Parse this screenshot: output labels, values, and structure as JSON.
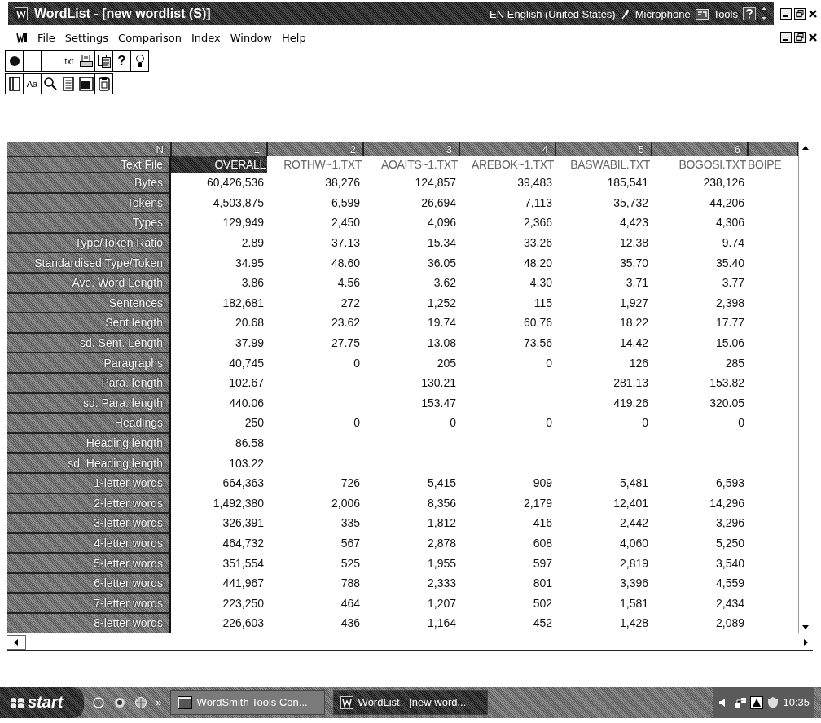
{
  "window": {
    "title": "WordList - [new wordlist (S)]"
  },
  "language_bar": {
    "language": "EN English (United States)",
    "microphone": "Microphone",
    "tools": "Tools"
  },
  "menu": [
    "File",
    "Settings",
    "Comparison",
    "Index",
    "Window",
    "Help"
  ],
  "toolbars": [
    [
      {
        "kind": "icon"
      },
      {
        "kind": "icon"
      },
      {
        "kind": "icon"
      },
      {
        "kind": "text",
        "label": ".txt"
      },
      {
        "kind": "icon"
      },
      {
        "kind": "icon"
      },
      {
        "kind": "text",
        "label": "?"
      },
      {
        "kind": "icon"
      }
    ],
    [
      {
        "kind": "icon"
      },
      {
        "kind": "text",
        "label": "Aa"
      },
      {
        "kind": "icon"
      },
      {
        "kind": "icon"
      },
      {
        "kind": "icon"
      },
      {
        "kind": "icon"
      }
    ]
  ],
  "grid": {
    "corner": "N",
    "file_row_label": "Text File",
    "columns": [
      {
        "number": "1",
        "file": "OVERALL",
        "selected": true
      },
      {
        "number": "2",
        "file": "ROTHW~1.TXT",
        "selected": false
      },
      {
        "number": "3",
        "file": "AOAITS~1.TXT",
        "selected": false
      },
      {
        "number": "4",
        "file": "AREBOK~1.TXT",
        "selected": false
      },
      {
        "number": "5",
        "file": "BASWABIL.TXT",
        "selected": false
      },
      {
        "number": "6",
        "file": "BOGOSI.TXT",
        "selected": false
      },
      {
        "file": "BOIPE",
        "selected": false
      }
    ],
    "rows": [
      {
        "label": "Bytes",
        "values": {
          "column_1": "60,426,536",
          "column_2": "38,276",
          "column_3": "124,857",
          "column_4": "39,483",
          "column_5": "185,541",
          "column_6": "238,126"
        }
      },
      {
        "label": "Tokens",
        "values": {
          "column_1": "4,503,875",
          "column_2": "6,599",
          "column_3": "26,694",
          "column_4": "7,113",
          "column_5": "35,732",
          "column_6": "44,206"
        }
      },
      {
        "label": "Types",
        "values": {
          "column_1": "129,949",
          "column_2": "2,450",
          "column_3": "4,096",
          "column_4": "2,366",
          "column_5": "4,423",
          "column_6": "4,306"
        }
      },
      {
        "label": "Type/Token Ratio",
        "values": {
          "column_1": "2.89",
          "column_2": "37.13",
          "column_3": "15.34",
          "column_4": "33.26",
          "column_5": "12.38",
          "column_6": "9.74"
        }
      },
      {
        "label": "Standardised Type/Token",
        "values": {
          "column_1": "34.95",
          "column_2": "48.60",
          "column_3": "36.05",
          "column_4": "48.20",
          "column_5": "35.70",
          "column_6": "35.40"
        }
      },
      {
        "label": "Ave. Word Length",
        "values": {
          "column_1": "3.86",
          "column_2": "4.56",
          "column_3": "3.62",
          "column_4": "4.30",
          "column_5": "3.71",
          "column_6": "3.77"
        }
      },
      {
        "label": "Sentences",
        "values": {
          "column_1": "182,681",
          "column_2": "272",
          "column_3": "1,252",
          "column_4": "115",
          "column_5": "1,927",
          "column_6": "2,398"
        }
      },
      {
        "label": "Sent length",
        "values": {
          "column_1": "20.68",
          "column_2": "23.62",
          "column_3": "19.74",
          "column_4": "60.76",
          "column_5": "18.22",
          "column_6": "17.77"
        }
      },
      {
        "label": "sd. Sent. Length",
        "values": {
          "column_1": "37.99",
          "column_2": "27.75",
          "column_3": "13.08",
          "column_4": "73.56",
          "column_5": "14.42",
          "column_6": "15.06"
        }
      },
      {
        "label": "Paragraphs",
        "values": {
          "column_1": "40,745",
          "column_2": "0",
          "column_3": "205",
          "column_4": "0",
          "column_5": "126",
          "column_6": "285"
        }
      },
      {
        "label": "Para. length",
        "values": {
          "column_1": "102.67",
          "column_3": "130.21",
          "column_5": "281.13",
          "column_6": "153.82"
        }
      },
      {
        "label": "sd. Para. length",
        "values": {
          "column_1": "440.06",
          "column_3": "153.47",
          "column_5": "419.26",
          "column_6": "320.05"
        }
      },
      {
        "label": "Headings",
        "values": {
          "column_1": "250",
          "column_2": "0",
          "column_3": "0",
          "column_4": "0",
          "column_5": "0",
          "column_6": "0"
        }
      },
      {
        "label": "Heading length",
        "values": {
          "column_1": "86.58"
        }
      },
      {
        "label": "sd. Heading length",
        "values": {
          "column_1": "103.22"
        }
      },
      {
        "label": "1-letter words",
        "values": {
          "column_1": "664,363",
          "column_2": "726",
          "column_3": "5,415",
          "column_4": "909",
          "column_5": "5,481",
          "column_6": "6,593"
        }
      },
      {
        "label": "2-letter words",
        "values": {
          "column_1": "1,492,380",
          "column_2": "2,006",
          "column_3": "8,356",
          "column_4": "2,179",
          "column_5": "12,401",
          "column_6": "14,296"
        }
      },
      {
        "label": "3-letter words",
        "values": {
          "column_1": "326,391",
          "column_2": "335",
          "column_3": "1,812",
          "column_4": "416",
          "column_5": "2,442",
          "column_6": "3,296"
        }
      },
      {
        "label": "4-letter words",
        "values": {
          "column_1": "464,732",
          "column_2": "567",
          "column_3": "2,878",
          "column_4": "608",
          "column_5": "4,060",
          "column_6": "5,250"
        }
      },
      {
        "label": "5-letter words",
        "values": {
          "column_1": "351,554",
          "column_2": "525",
          "column_3": "1,955",
          "column_4": "597",
          "column_5": "2,819",
          "column_6": "3,540"
        }
      },
      {
        "label": "6-letter words",
        "values": {
          "column_1": "441,967",
          "column_2": "788",
          "column_3": "2,333",
          "column_4": "801",
          "column_5": "3,396",
          "column_6": "4,559"
        }
      },
      {
        "label": "7-letter words",
        "values": {
          "column_1": "223,250",
          "column_2": "464",
          "column_3": "1,207",
          "column_4": "502",
          "column_5": "1,581",
          "column_6": "2,434"
        }
      },
      {
        "label": "8-letter words",
        "values": {
          "column_1": "226,603",
          "column_2": "436",
          "column_3": "1,164",
          "column_4": "452",
          "column_5": "1,428",
          "column_6": "2,089"
        }
      }
    ]
  },
  "taskbar": {
    "start": "start",
    "more": "»",
    "tasks": [
      {
        "label": "WordSmith Tools Con...",
        "selected": false
      },
      {
        "label": "WordList - [new word...",
        "selected": true
      }
    ],
    "clock": "10:35"
  }
}
